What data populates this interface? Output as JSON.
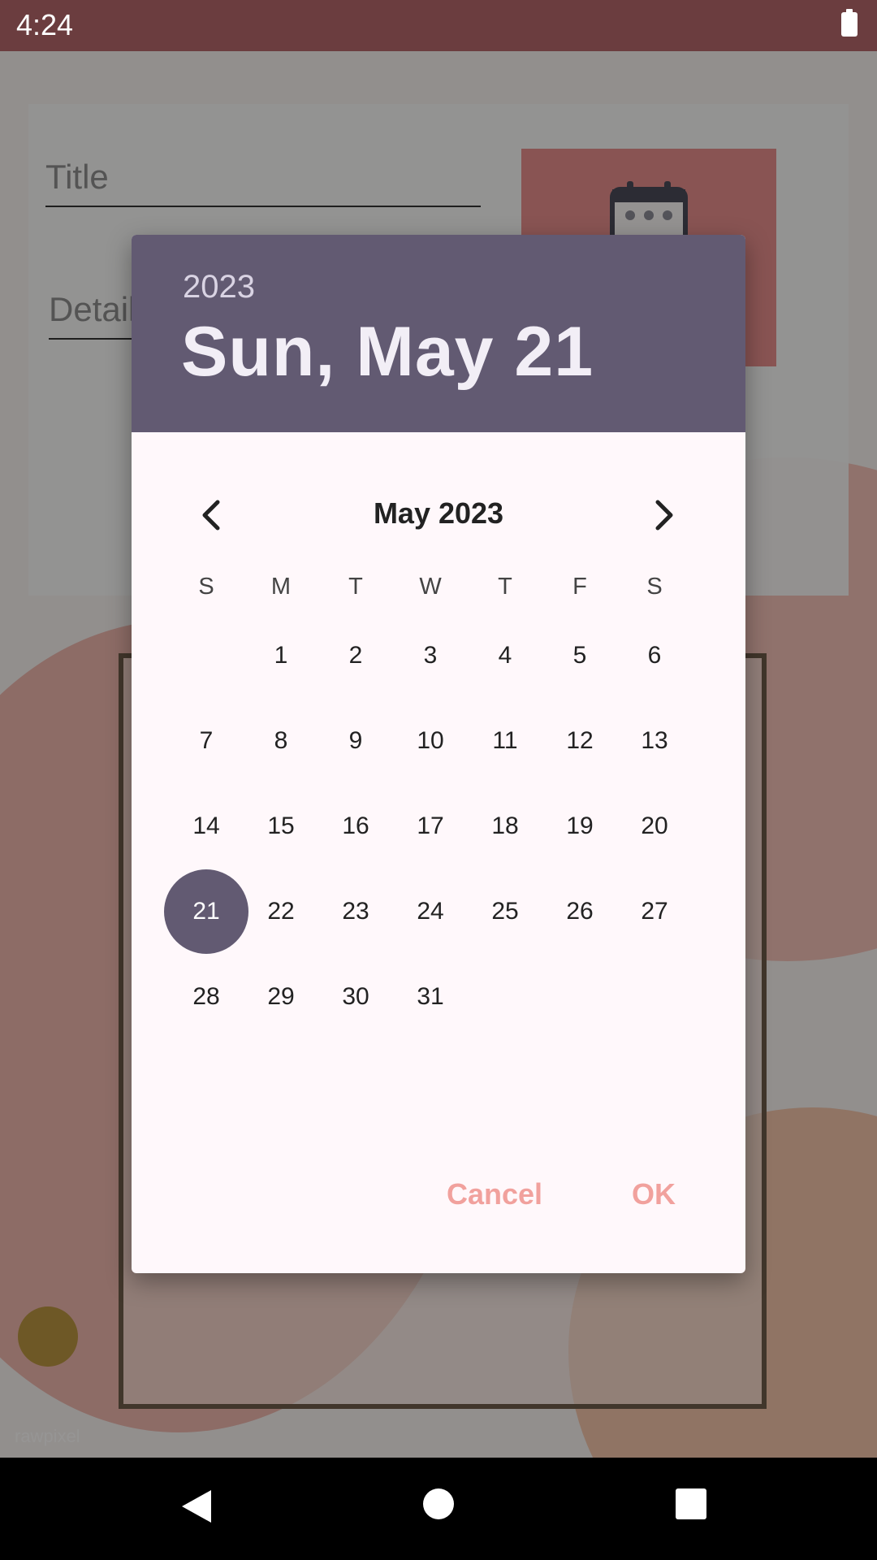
{
  "status_bar": {
    "time": "4:24"
  },
  "app": {
    "title_placeholder": "Title",
    "details_placeholder": "Details",
    "watermark": "rawpixel"
  },
  "dialog": {
    "header": {
      "year": "2023",
      "selected_date": "Sun, May 21"
    },
    "month_label": "May 2023",
    "weekdays": [
      "S",
      "M",
      "T",
      "W",
      "T",
      "F",
      "S"
    ],
    "weeks": [
      [
        "",
        "1",
        "2",
        "3",
        "4",
        "5",
        "6"
      ],
      [
        "7",
        "8",
        "9",
        "10",
        "11",
        "12",
        "13"
      ],
      [
        "14",
        "15",
        "16",
        "17",
        "18",
        "19",
        "20"
      ],
      [
        "21",
        "22",
        "23",
        "24",
        "25",
        "26",
        "27"
      ],
      [
        "28",
        "29",
        "30",
        "31",
        "",
        "",
        ""
      ]
    ],
    "selected_day": "21",
    "cancel_label": "Cancel",
    "ok_label": "OK"
  },
  "icons": {
    "prev": "chevron-left-icon",
    "next": "chevron-right-icon",
    "battery": "battery-icon",
    "calendar": "calendar-icon"
  },
  "colors": {
    "header_bg": "#625a72",
    "selected_bg": "#625a72",
    "action_text": "#f1a19d",
    "status_bar": "#6b3d3f"
  }
}
